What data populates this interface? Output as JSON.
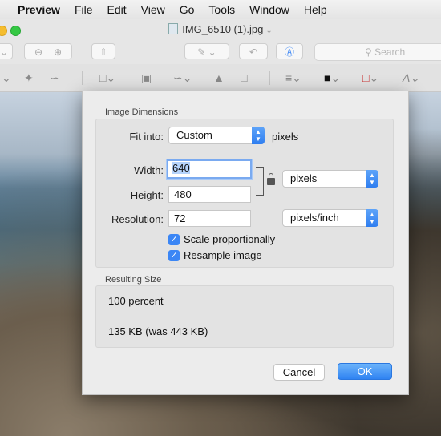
{
  "menubar": {
    "app": "Preview",
    "items": [
      "File",
      "Edit",
      "View",
      "Go",
      "Tools",
      "Window",
      "Help"
    ]
  },
  "window": {
    "title": "IMG_6510 (1).jpg",
    "search_placeholder": "Search"
  },
  "dialog": {
    "image_dimensions_title": "Image Dimensions",
    "fit_into_label": "Fit into:",
    "fit_into_value": "Custom",
    "fit_into_unit": "pixels",
    "width_label": "Width:",
    "width_value": "640",
    "height_label": "Height:",
    "height_value": "480",
    "size_unit": "pixels",
    "resolution_label": "Resolution:",
    "resolution_value": "72",
    "resolution_unit": "pixels/inch",
    "scale_label": "Scale proportionally",
    "scale_checked": true,
    "resample_label": "Resample image",
    "resample_checked": true,
    "resulting_size_title": "Resulting Size",
    "result_percent": "100 percent",
    "result_size": "135 KB (was 443 KB)",
    "cancel_label": "Cancel",
    "ok_label": "OK"
  },
  "colors": {
    "accent": "#2f83f2",
    "checkbox": "#3b86f5"
  }
}
